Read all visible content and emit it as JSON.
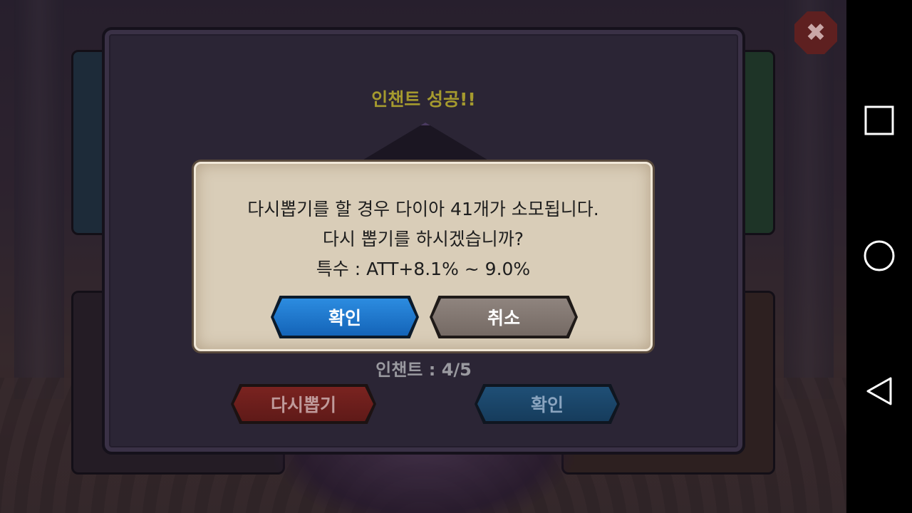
{
  "game": {
    "enchant_title": "인챈트 성공!!",
    "enchant_count": "인챈트 : 4/5",
    "reroll_label": "다시뽑기",
    "confirm_label": "확인",
    "close_icon": "close-icon"
  },
  "dialog": {
    "line1": "다시뽑기를 할 경우 다이아 41개가 소모됩니다.",
    "line2": "다시 뽑기를 하시겠습니까?",
    "line3": "특수 : ATT+8.1% ~ 9.0%",
    "confirm_label": "확인",
    "cancel_label": "취소"
  },
  "navbar": {
    "recents_icon": "square-icon",
    "home_icon": "circle-icon",
    "back_icon": "triangle-back-icon"
  },
  "colors": {
    "title": "#a59a2e",
    "confirm_blue": "#1e78d0",
    "cancel_gray": "#857a74",
    "reroll_red": "#7a2320"
  }
}
